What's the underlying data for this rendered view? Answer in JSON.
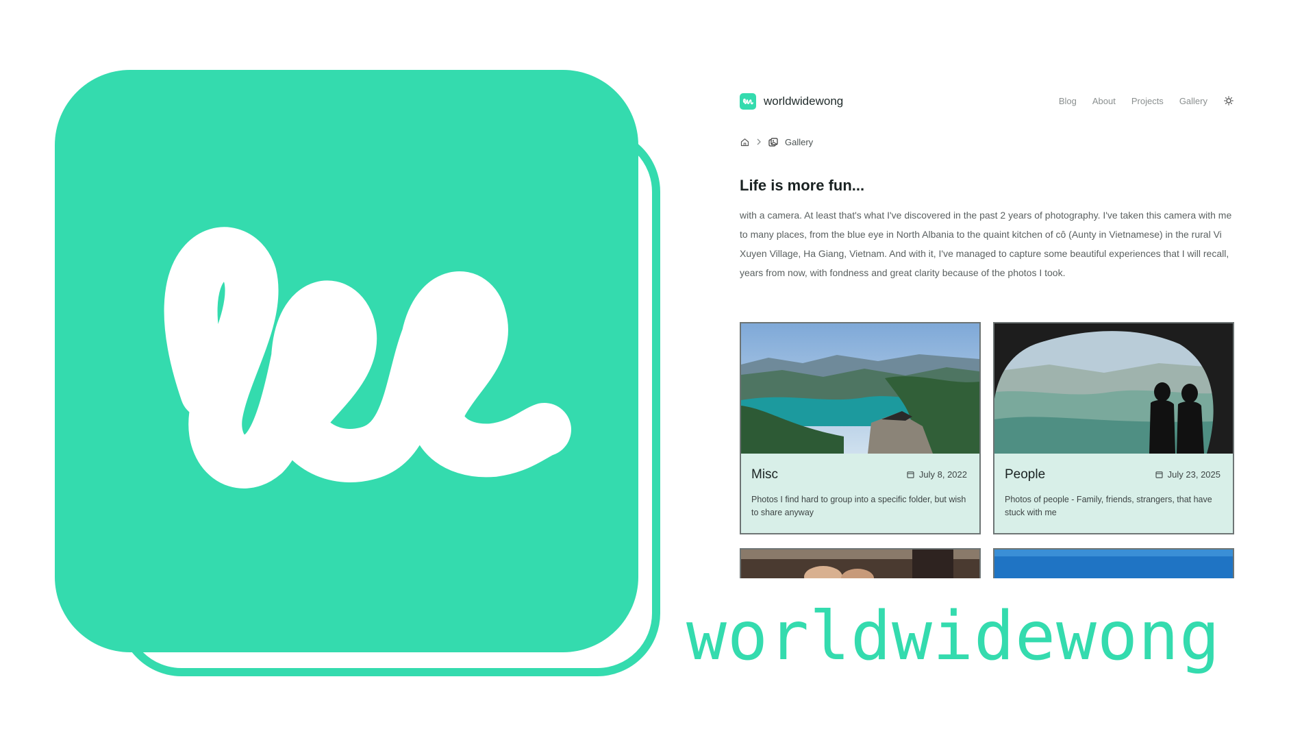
{
  "brand": {
    "name": "worldwidewong",
    "accent": "#34dbae",
    "icon": "ww-logo-icon"
  },
  "site": {
    "nav": {
      "brand": "worldwidewong",
      "links": [
        "Blog",
        "About",
        "Projects",
        "Gallery"
      ],
      "theme_toggle_icon": "sun-icon"
    },
    "breadcrumb": {
      "home_icon": "home-icon",
      "separator_icon": "chevron-right-icon",
      "current_icon": "gallery-icon",
      "current_label": "Gallery"
    },
    "heading": "Life is more fun...",
    "intro": "with a camera. At least that's what I've discovered in the past 2 years of photography. I've taken this camera with me to many places, from the blue eye in North Albania to the quaint kitchen of cô (Aunty in Vietnamese) in the rural Vi Xuyen Village, Ha Giang, Vietnam. And with it, I've managed to capture some beautiful experiences that I will recall, years from now, with fondness and great clarity because of the photos I took.",
    "cards": [
      {
        "title": "Misc",
        "date": "July 8, 2022",
        "description": "Photos I find hard to group into a specific folder, but wish to share anyway"
      },
      {
        "title": "People",
        "date": "July 23, 2025",
        "description": "Photos of people - Family, friends, strangers, that have stuck with me"
      }
    ]
  },
  "colors": {
    "card_background": "#d8efe8",
    "card_border": "#6d7474",
    "text_muted": "#8a8f8f"
  }
}
